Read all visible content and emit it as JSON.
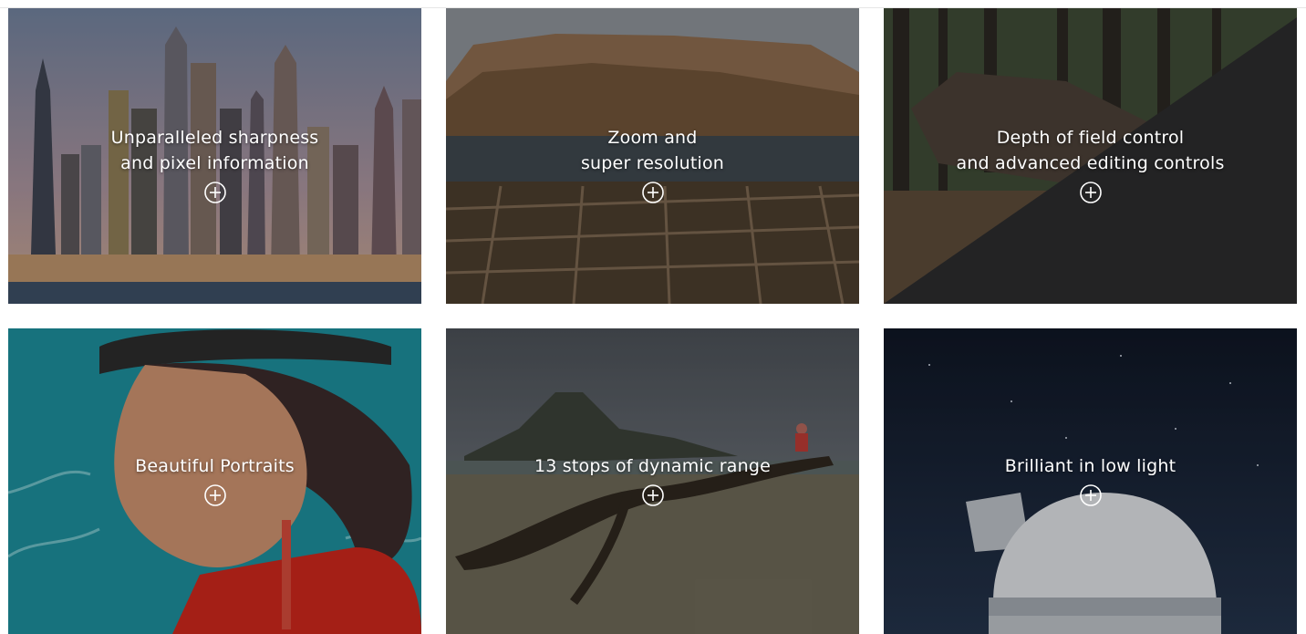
{
  "cards": [
    {
      "id": "sharpness",
      "lines": [
        "Unparalleled sharpness",
        "and pixel information"
      ],
      "icon": "plus-circle-icon"
    },
    {
      "id": "zoom",
      "lines": [
        "Zoom and",
        "super resolution"
      ],
      "icon": "plus-circle-icon"
    },
    {
      "id": "depth",
      "lines": [
        "Depth of field control",
        "and advanced editing controls"
      ],
      "icon": "plus-circle-icon"
    },
    {
      "id": "portraits",
      "lines": [
        "Beautiful Portraits"
      ],
      "icon": "plus-circle-icon"
    },
    {
      "id": "dynamic",
      "lines": [
        "13 stops of dynamic range"
      ],
      "icon": "plus-circle-icon"
    },
    {
      "id": "lowlight",
      "lines": [
        "Brilliant in low light"
      ],
      "icon": "plus-circle-icon"
    }
  ],
  "colors": {
    "caption_text": "#ffffff",
    "page_background": "#ffffff"
  }
}
